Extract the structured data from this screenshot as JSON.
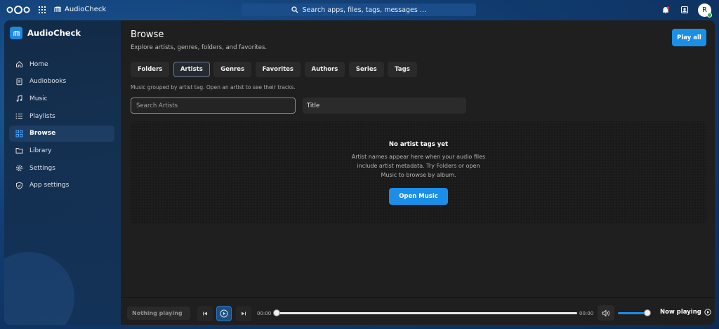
{
  "topbar": {
    "app_name": "AudioCheck",
    "search_placeholder": "Search apps, files, tags, messages …",
    "avatar_initial": "R"
  },
  "sidebar": {
    "title": "AudioCheck",
    "items": [
      {
        "label": "Home",
        "icon": "home-icon"
      },
      {
        "label": "Audiobooks",
        "icon": "book-icon"
      },
      {
        "label": "Music",
        "icon": "music-note-icon"
      },
      {
        "label": "Playlists",
        "icon": "playlist-icon"
      },
      {
        "label": "Browse",
        "icon": "grid-icon",
        "active": true
      },
      {
        "label": "Library",
        "icon": "folder-icon"
      },
      {
        "label": "Settings",
        "icon": "gear-icon"
      },
      {
        "label": "App settings",
        "icon": "shield-icon"
      }
    ]
  },
  "main": {
    "title": "Browse",
    "subtitle": "Explore artists, genres, folders, and favorites.",
    "play_all_label": "Play all",
    "tabs": [
      {
        "label": "Folders"
      },
      {
        "label": "Artists",
        "active": true
      },
      {
        "label": "Genres"
      },
      {
        "label": "Favorites"
      },
      {
        "label": "Authors"
      },
      {
        "label": "Series"
      },
      {
        "label": "Tags"
      }
    ],
    "hint": "Music grouped by artist tag. Open an artist to see their tracks.",
    "search_placeholder": "Search Artists",
    "sort_value": "Title",
    "empty": {
      "title": "No artist tags yet",
      "body": "Artist names appear here when your audio files include artist metadata. Try Folders or open Music to browse by album.",
      "button_label": "Open Music"
    }
  },
  "player": {
    "now_playing_chip": "Nothing playing",
    "time_current": "00:00",
    "time_total": "00:00",
    "progress": 0,
    "volume": 1.0,
    "now_playing_label": "Now playing"
  },
  "colors": {
    "accent": "#1b8ee8",
    "panel": "#1f1f1f",
    "background": "#123f75"
  }
}
